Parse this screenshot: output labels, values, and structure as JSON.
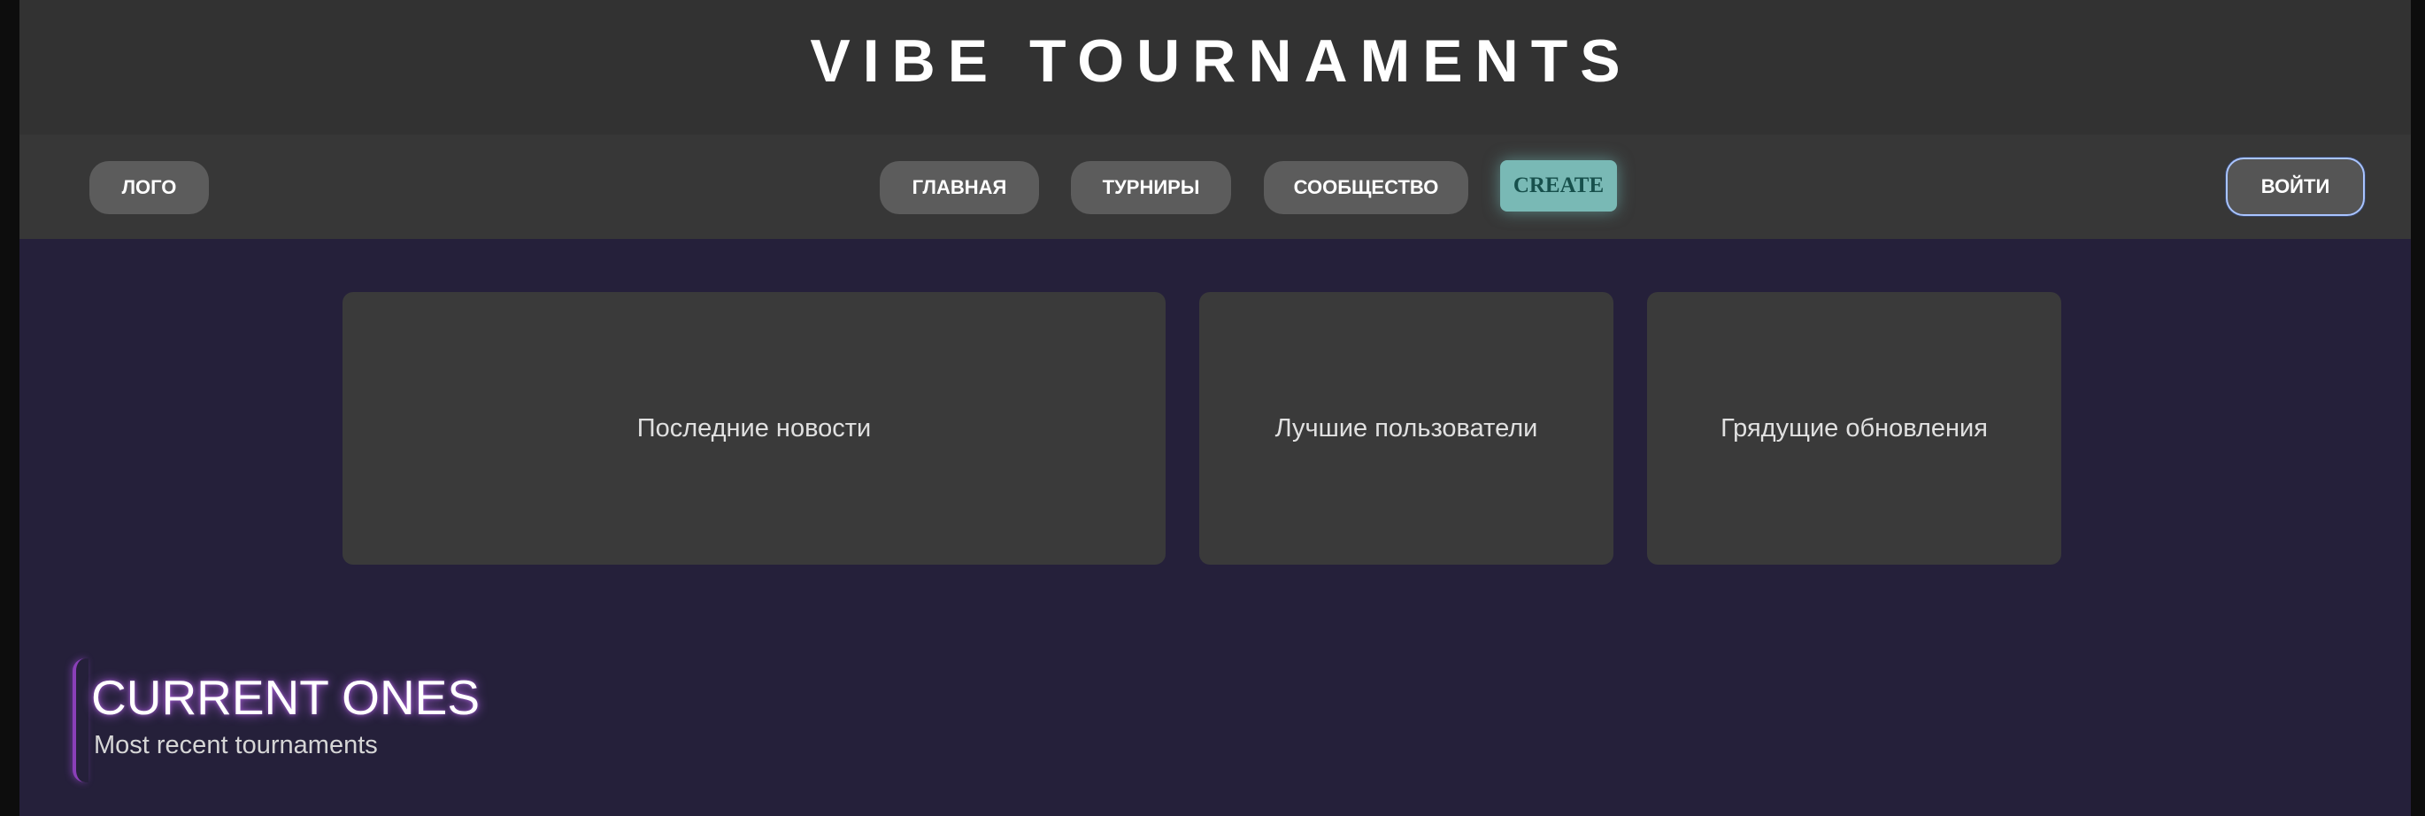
{
  "header": {
    "title": "VIBE TOURNAMENTS"
  },
  "nav": {
    "logo_label": "ЛОГО",
    "items": [
      {
        "label": "ГЛАВНАЯ"
      },
      {
        "label": "ТУРНИРЫ"
      },
      {
        "label": "СООБЩЕСТВО"
      }
    ],
    "create_label": "CREATE",
    "login_label": "ВОЙТИ"
  },
  "cards": [
    {
      "label": "Последние новости"
    },
    {
      "label": "Лучшие пользователи"
    },
    {
      "label": "Грядущие обновления"
    }
  ],
  "section": {
    "title": "CURRENT ONES",
    "subtitle": "Most recent tournaments"
  },
  "colors": {
    "page_background": "#25203a",
    "header_background": "#323232",
    "nav_background": "#373737",
    "button_background": "#5c5c5c",
    "create_accent": "#79b9b5",
    "login_border": "#a9c4ff",
    "section_glow": "#c86eff"
  }
}
